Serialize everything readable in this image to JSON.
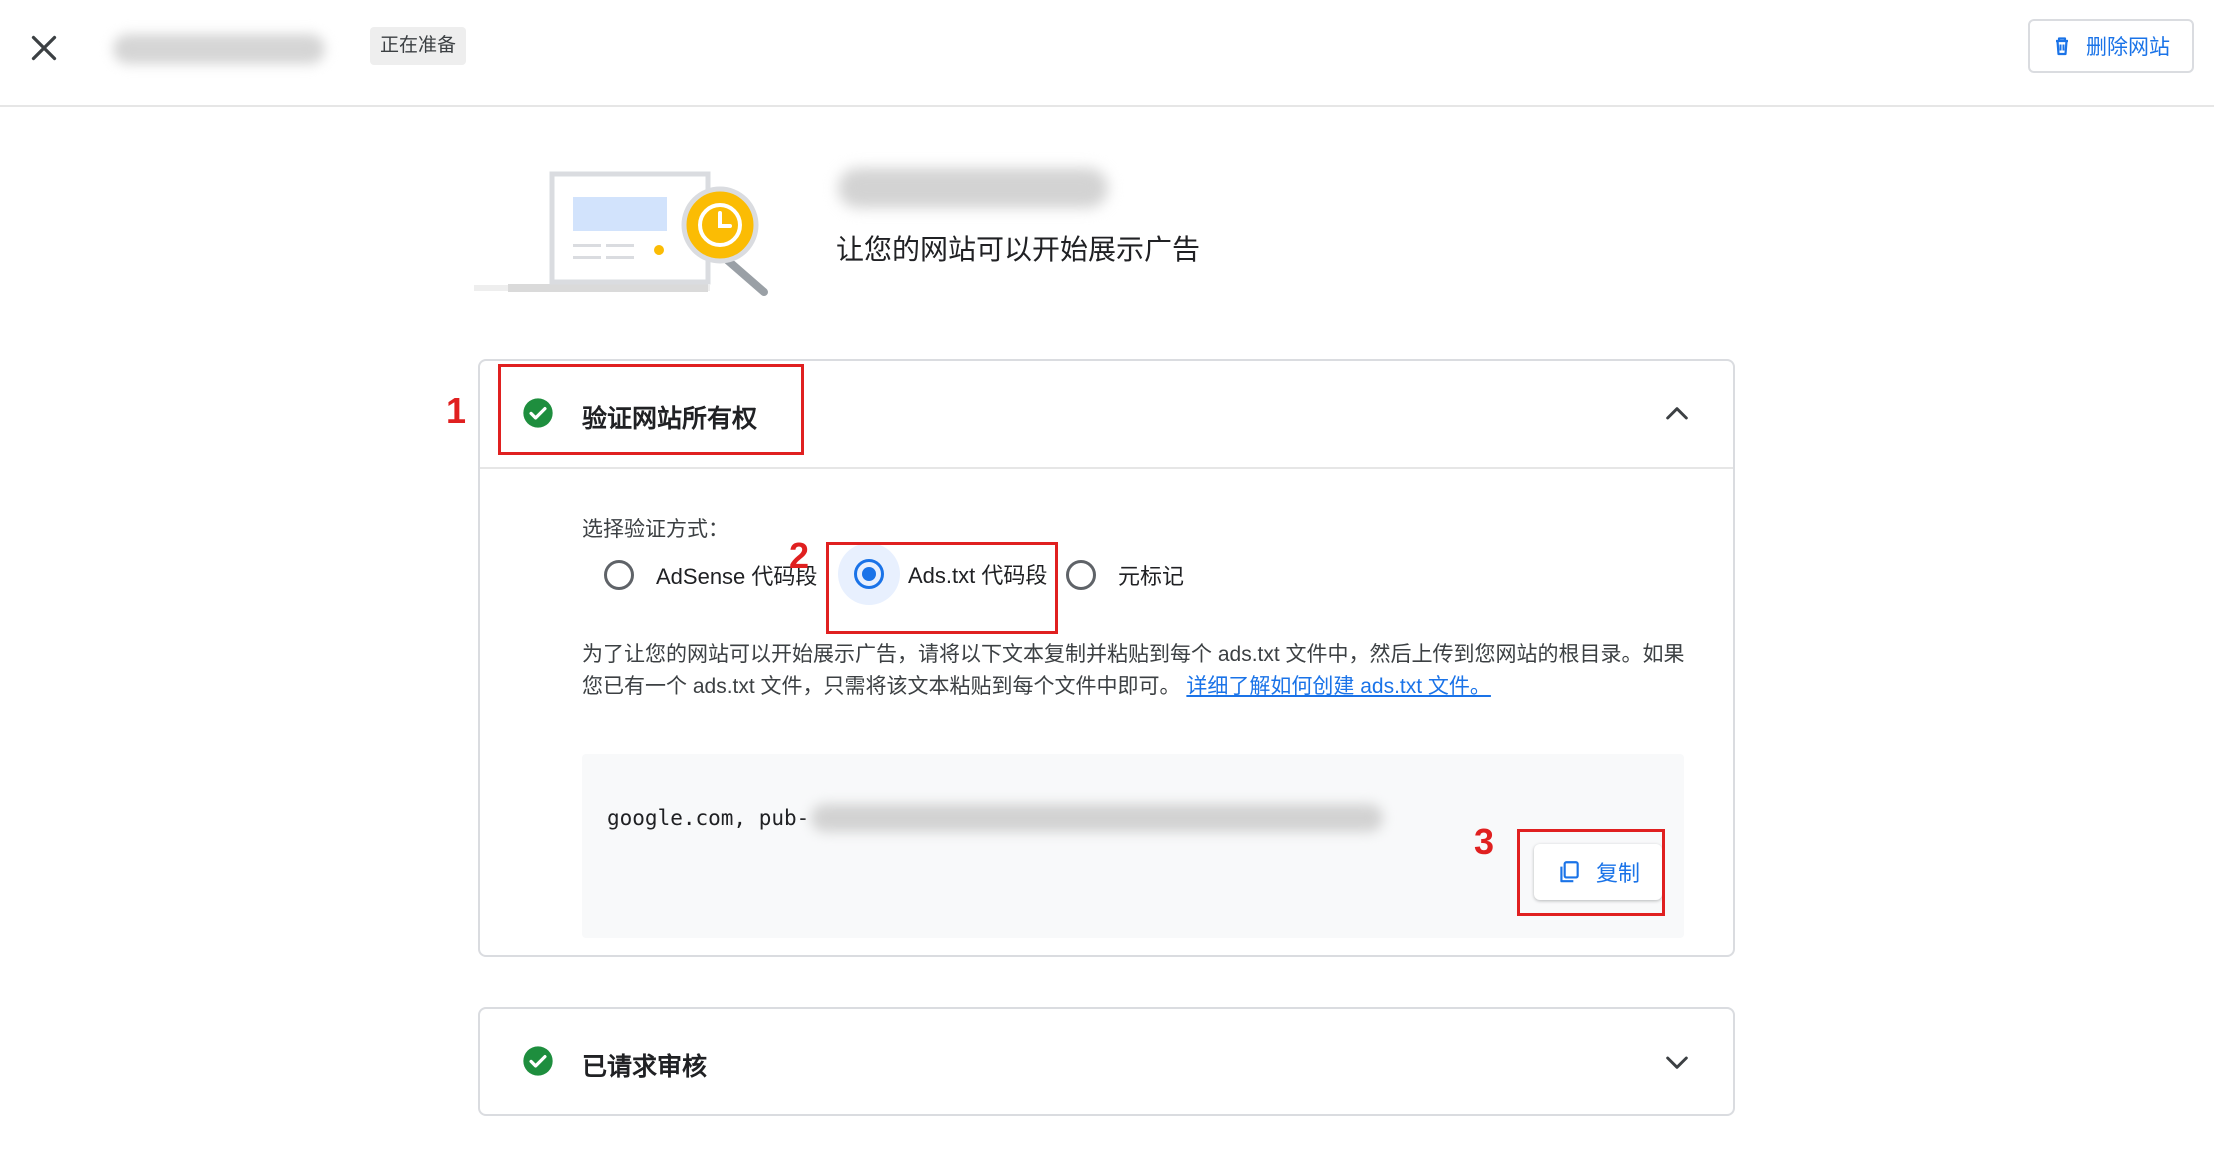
{
  "topbar": {
    "status_chip": "正在准备",
    "delete_site_label": "删除网站"
  },
  "hero": {
    "subtitle": "让您的网站可以开始展示广告"
  },
  "ownership_card": {
    "title": "验证网站所有权",
    "method_label": "选择验证方式：",
    "options": [
      {
        "label": "AdSense 代码段",
        "selected": false
      },
      {
        "label": "Ads.txt 代码段",
        "selected": true
      },
      {
        "label": "元标记",
        "selected": false
      }
    ],
    "instruction_text": "为了让您的网站可以开始展示广告，请将以下文本复制并粘贴到每个 ads.txt 文件中，然后上传到您网站的根目录。如果您已有一个 ads.txt 文件，只需将该文本粘贴到每个文件中即可。",
    "learn_more_link": "详细了解如何创建 ads.txt 文件。",
    "code_prefix": "google.com, pub-",
    "copy_label": "复制"
  },
  "review_card": {
    "title": "已请求审核"
  },
  "annotations": [
    "1",
    "2",
    "3"
  ],
  "colors": {
    "accent": "#1a73e8",
    "success": "#1e8e3e",
    "annotation": "#e02020",
    "warning": "#fbbc04"
  },
  "icons": {
    "close": "close-icon",
    "delete": "trash-icon",
    "check": "check-circle-icon",
    "expand": "chevron-up-icon",
    "collapse": "chevron-down-icon",
    "copy": "copy-icon"
  }
}
